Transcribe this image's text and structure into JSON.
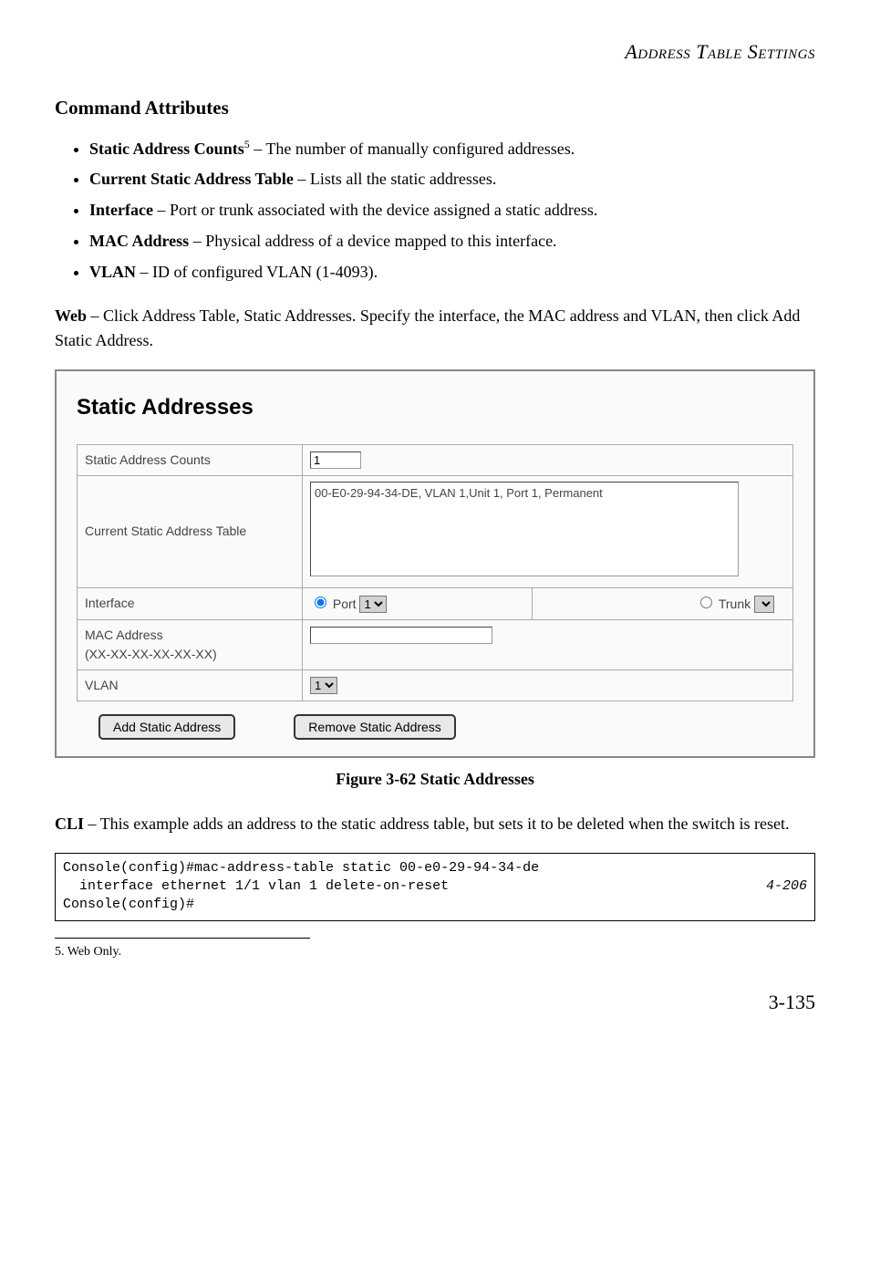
{
  "header": {
    "title": "Address Table Settings"
  },
  "section": {
    "heading": "Command Attributes",
    "bullets": [
      {
        "term": "Static Address Counts",
        "sup": "5",
        "desc": " – The number of manually configured addresses."
      },
      {
        "term": "Current Static Address Table",
        "sup": "",
        "desc": " – Lists all the static addresses."
      },
      {
        "term": "Interface",
        "sup": "",
        "desc": " – Port or trunk associated with the device assigned a static address."
      },
      {
        "term": "MAC Address",
        "sup": "",
        "desc": " – Physical address of a device mapped to this interface."
      },
      {
        "term": "VLAN",
        "sup": "",
        "desc": " – ID of configured VLAN (1-4093)."
      }
    ],
    "web_lead": "Web",
    "web_body": " – Click Address Table, Static Addresses. Specify the interface, the MAC address and VLAN, then click Add Static Address.",
    "cli_lead": "CLI",
    "cli_body": " – This example adds an address to the static address table, but sets it to be deleted when the switch is reset."
  },
  "screenshot": {
    "title": "Static Addresses",
    "rows": {
      "count_label": "Static Address Counts",
      "count_value": "1",
      "table_label": "Current Static Address Table",
      "table_value": "00-E0-29-94-34-DE, VLAN 1,Unit 1, Port 1, Permanent",
      "iface_label": "Interface",
      "port_label": " Port ",
      "port_value": "1",
      "trunk_label": " Trunk ",
      "trunk_value": "",
      "mac_label": "MAC Address",
      "mac_sub": "(XX-XX-XX-XX-XX-XX)",
      "mac_value": "",
      "vlan_label": "VLAN",
      "vlan_value": "1"
    },
    "buttons": {
      "add": "Add Static Address",
      "remove": "Remove Static Address"
    }
  },
  "figcaption": "Figure 3-62  Static Addresses",
  "code": {
    "line1": "Console(config)#mac-address-table static 00-e0-29-94-34-de",
    "line2": "  interface ethernet 1/1 vlan 1 delete-on-reset",
    "ref": "4-206",
    "line3": "Console(config)#"
  },
  "footnote": "5.  Web Only.",
  "page_number": "3-135"
}
